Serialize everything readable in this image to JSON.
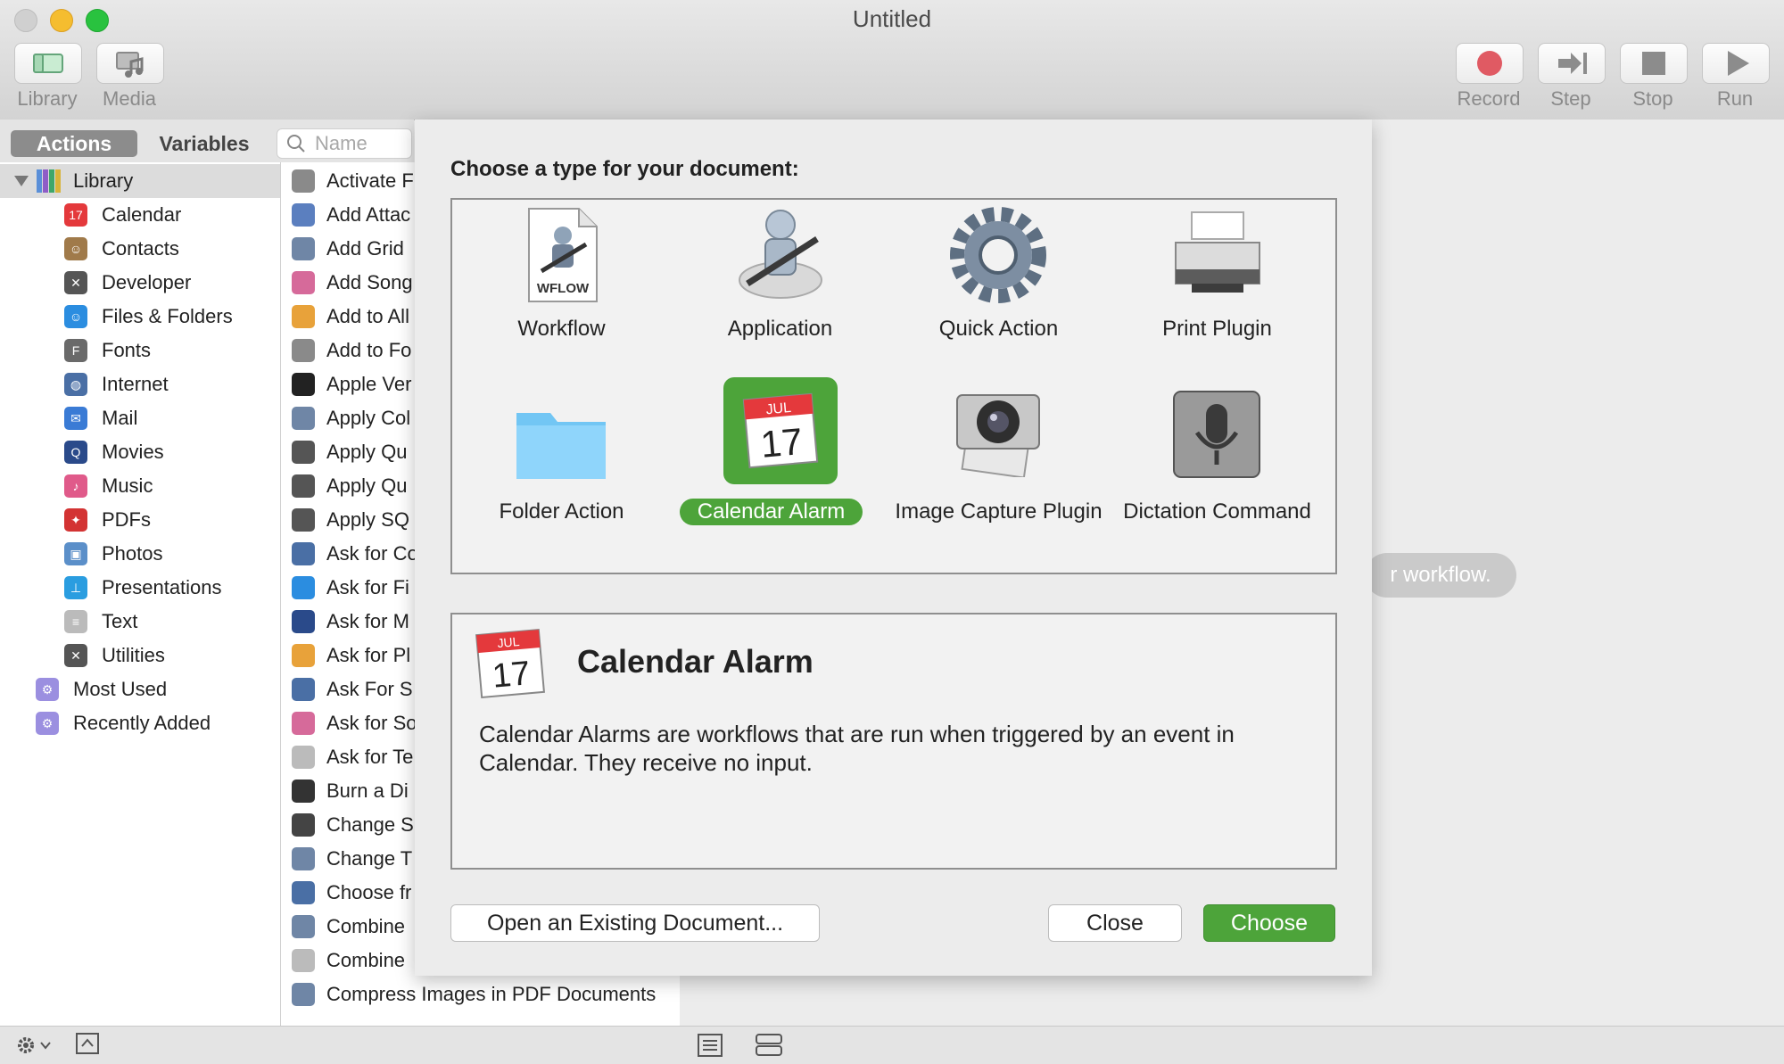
{
  "window": {
    "title": "Untitled"
  },
  "toolbar": {
    "left": [
      {
        "label": "Library"
      },
      {
        "label": "Media"
      }
    ],
    "right": [
      {
        "label": "Record"
      },
      {
        "label": "Step"
      },
      {
        "label": "Stop"
      },
      {
        "label": "Run"
      }
    ]
  },
  "tabs": {
    "actions": "Actions",
    "variables": "Variables"
  },
  "search": {
    "placeholder": "Name"
  },
  "library": {
    "root": "Library",
    "items": [
      "Calendar",
      "Contacts",
      "Developer",
      "Files & Folders",
      "Fonts",
      "Internet",
      "Mail",
      "Movies",
      "Music",
      "PDFs",
      "Photos",
      "Presentations",
      "Text",
      "Utilities"
    ],
    "extra": [
      "Most Used",
      "Recently Added"
    ]
  },
  "actions": [
    "Activate F",
    "Add Attac",
    "Add Grid",
    "Add Song",
    "Add to All",
    "Add to Fo",
    "Apple Ver",
    "Apply Col",
    "Apply Qu",
    "Apply Qu",
    "Apply SQ",
    "Ask for Co",
    "Ask for Fi",
    "Ask for M",
    "Ask for Pl",
    "Ask For S",
    "Ask for So",
    "Ask for Te",
    "Burn a Di",
    "Change S",
    "Change T",
    "Choose fr",
    "Combine",
    "Combine",
    "Compress Images in PDF Documents"
  ],
  "workflow_hint": "r workflow.",
  "dialog": {
    "prompt": "Choose a type for your document:",
    "types": [
      {
        "label": "Workflow",
        "icon": "wflow-document-icon"
      },
      {
        "label": "Application",
        "icon": "automator-robot-icon"
      },
      {
        "label": "Quick Action",
        "icon": "gear-icon"
      },
      {
        "label": "Print Plugin",
        "icon": "printer-icon"
      },
      {
        "label": "Folder Action",
        "icon": "folder-icon"
      },
      {
        "label": "Calendar Alarm",
        "icon": "calendar-icon",
        "selected": true
      },
      {
        "label": "Image Capture Plugin",
        "icon": "camera-icon"
      },
      {
        "label": "Dictation Command",
        "icon": "microphone-icon"
      }
    ],
    "wflow_text": "WFLOW",
    "calendar_month": "JUL",
    "calendar_day": "17",
    "description": {
      "title": "Calendar Alarm",
      "text": "Calendar Alarms are workflows that are run when triggered by an event in Calendar. They receive no input."
    },
    "buttons": {
      "open": "Open an Existing Document...",
      "close": "Close",
      "choose": "Choose"
    }
  },
  "colors": {
    "accent_green": "#4da43a",
    "record_red": "#e05a63"
  }
}
